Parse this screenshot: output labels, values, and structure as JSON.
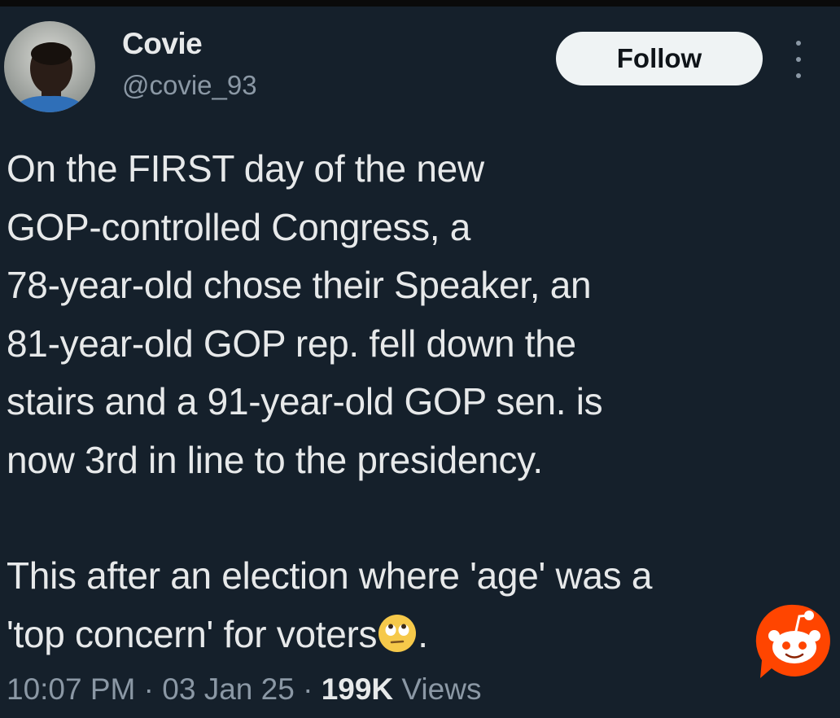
{
  "user": {
    "display_name": "Covie",
    "handle": "@covie_93",
    "avatar_icon": "profile-photo"
  },
  "follow_label": "Follow",
  "more_icon": "more-vertical-icon",
  "tweet": {
    "paragraph1": "On the FIRST day of the new\nGOP-controlled Congress, a\n78-year-old chose their Speaker, an\n81-year-old GOP rep. fell down the\nstairs and a 91-year-old GOP sen. is\nnow 3rd in line to the presidency.",
    "paragraph2_text": "This after an election where 'age' was a\n'top concern' for voters",
    "paragraph2_end": ".",
    "emoji": "eye-roll-emoji"
  },
  "meta": {
    "time": "10:07 PM",
    "separator": " · ",
    "date": "03 Jan 25",
    "views_count": "199K",
    "views_label": "Views"
  },
  "watermark_icon": "reddit-icon",
  "colors": {
    "background": "#15202b",
    "text": "#e7e9ea",
    "secondary": "#8b98a5",
    "button": "#eff3f4",
    "reddit": "#ff4500"
  }
}
